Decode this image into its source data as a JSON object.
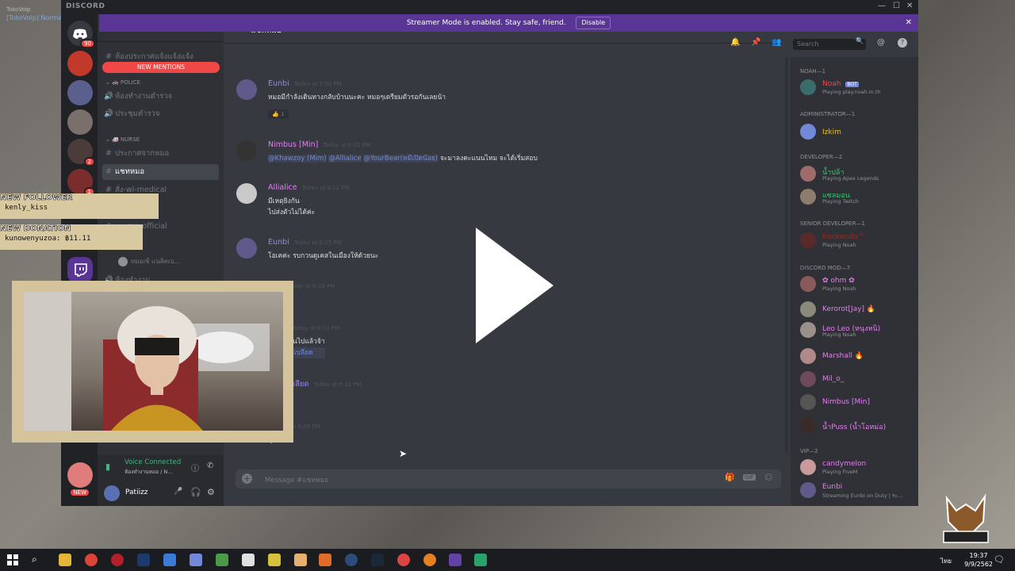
{
  "desktop": {
    "top_text": "TokoVoip",
    "link_text": "[TokoVoip] Normal"
  },
  "window": {
    "brand": "DISCORD"
  },
  "streamer": {
    "message": "Streamer Mode is enabled. Stay safe, friend.",
    "disable": "Disable"
  },
  "server": {
    "name": "NOAH",
    "new_mentions": "NEW MENTIONS"
  },
  "guilds": {
    "badge_top": "90",
    "badge_a": "2",
    "badge_b": "1",
    "new": "NEW",
    "badge_bottom": "2"
  },
  "channels": {
    "cut_top": "ห้องประกาศแจ้งแจ้งแจ้ง",
    "cat_police": "POLICE",
    "police_1": "ห้องทำงานตำรวจ",
    "police_2": "ประชุมตำรวจ",
    "cat_nurse": "NURSE",
    "nurse_1": "ประกาศจากหมอ",
    "nurse_2": "แชทหมอ",
    "nurse_3": "สั่ง-wl-medical",
    "nurse_4": "หมอ",
    "nurse_5": "เอกสาร-official",
    "nurse_6": "หมอ",
    "voice_user": "หมอเช้ แนลิคเบ...",
    "voice_channel": "ห้องทำงาน"
  },
  "voice": {
    "status": "Voice Connected",
    "sub": "ห้องทำงานหมอ / N..."
  },
  "user": {
    "name": "Patiizz"
  },
  "chat": {
    "title": "แชทหมอ",
    "placeholder": "Message #แชทหมอ",
    "search": "Search"
  },
  "messages": [
    {
      "name": "Eunbi",
      "color": "#9b84ec",
      "time": "Today at 5:50 PM",
      "lines": [
        "หมอมีกำลังเดินทางกลับบ้านนะคะ หมอๆเตรียมตัวรอกันเลยน้า"
      ],
      "reaction": "1"
    },
    {
      "name": "Nimbus [Min]",
      "color": "#e67ef2",
      "time": "Today at 6:01 PM",
      "mentions": [
        "@Khawzoy (Mim)",
        "@Allialice",
        "@YourBear(หมีเปิดน้อย)"
      ],
      "tail": "จะมาลงคะแนนไหม จะได้เริ่มสอบ"
    },
    {
      "name": "Allialice",
      "color": "#e67ef2",
      "time": "Today at 6:12 PM",
      "lines": [
        "มีเหตุยิงกัน",
        "ไปส่งตัวไม่ได้ค่ะ"
      ]
    },
    {
      "name": "Eunbi",
      "color": "#9b84ec",
      "time": "Today at 6:25 PM",
      "lines": [
        "โอเคค่ะ รบกวนดูเคสในเมืองให้ด้วยนะ"
      ]
    },
    {
      "name": "rian",
      "color": "#e67ef2",
      "time": "Today at 6:28 PM",
      "lines": [
        ""
      ]
    },
    {
      "name": "[Min]",
      "color": "#e67ef2",
      "time": "Today at 6:33 PM",
      "lines": [
        "ลงคะแนนไปแล้วจ้า",
        "ช้าแนลิคเบลียด"
      ]
    },
    {
      "name": "แนลิคเบลียด",
      "color": "#9b84ec",
      "time": "Today at 6:32 PM",
      "lines": [
        "ค"
      ]
    },
    {
      "name": "",
      "color": "#9b84ec",
      "time": "Today at 6:40 PM",
      "lines": [
        "อุไปข้อ"
      ]
    }
  ],
  "members": {
    "roles": [
      "NOAH—1",
      "ADMINISTRATOR—1",
      "DEVELOPER—2",
      "SENIOR DEVELOPER—1",
      "DISCORD MOD—7",
      "VIP—2"
    ],
    "noah": {
      "name": "Noah",
      "tag": "BOT",
      "activity": "Playing play.noah.in.th"
    },
    "admin": {
      "name": "Izkim"
    },
    "devs": [
      {
        "name": "น้ำปล้า",
        "activity": "Playing Apex Legends"
      },
      {
        "name": "แซลมอน",
        "activity": "Playing Twitch"
      }
    ],
    "senior": {
      "name": "Ironkendo™",
      "activity": "Playing Noah"
    },
    "mods": [
      {
        "name": "✿ ohm ✿",
        "activity": "Playing Noah",
        "color": "#e67ef2"
      },
      {
        "name": "Kerorot[Jay] 🔥",
        "activity": "",
        "color": "#e67ef2"
      },
      {
        "name": "Leo Leo (หนุงหนิ)",
        "activity": "Playing Noah",
        "color": "#e67ef2"
      },
      {
        "name": "Marshall 🔥",
        "activity": "",
        "color": "#e67ef2"
      },
      {
        "name": "Mil_o_",
        "activity": "",
        "color": "#e67ef2"
      },
      {
        "name": "Nimbus [Min]",
        "activity": "",
        "color": "#e67ef2"
      },
      {
        "name": "น้ำPuss (น้ำโอหม่อ)",
        "activity": "",
        "color": "#e67ef2"
      }
    ],
    "vips": [
      {
        "name": "candymelon",
        "activity": "Playing FiveM"
      },
      {
        "name": "Eunbi",
        "activity": "Streaming Eunbi on Duty | ระ..."
      }
    ]
  },
  "overlay": {
    "follower_title": "NEW FOLLOWER",
    "follower_name": "kenly_kiss",
    "donation_title": "NEW DONATION",
    "donation_name": "kunowenyuzoa: ฿11.11"
  },
  "taskbar": {
    "time": "19:37",
    "date": "9/9/2562",
    "lang": "ไทย"
  }
}
